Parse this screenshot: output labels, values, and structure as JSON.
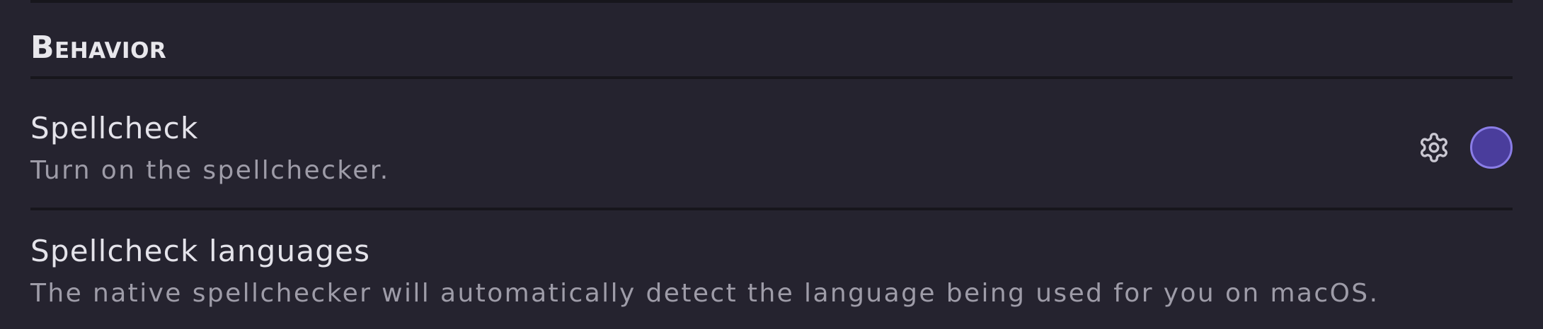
{
  "section": {
    "heading": "Behavior"
  },
  "settings": [
    {
      "name": "Spellcheck",
      "description": "Turn on the spellchecker.",
      "icon": "gear-icon",
      "toggle_on": true
    },
    {
      "name": "Spellcheck languages",
      "description": "The native spellchecker will automatically detect the language being used for you on macOS."
    }
  ],
  "colors": {
    "background": "#25232f",
    "divider": "#17161c",
    "accent": "#4a3d9c",
    "accent_border": "#8a7de6"
  }
}
